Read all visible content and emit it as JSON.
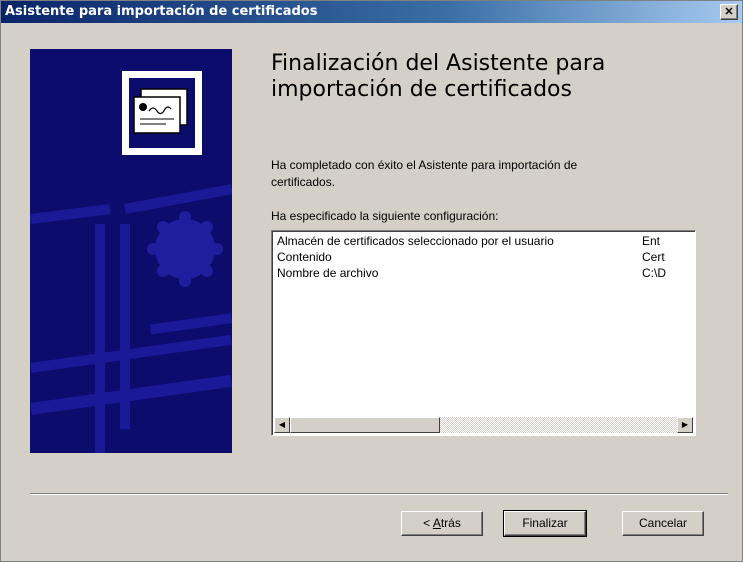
{
  "window": {
    "title": "Asistente para importación de certificados",
    "close_glyph": "✕"
  },
  "main": {
    "heading_line1": "Finalización del Asistente para",
    "heading_line2": "importación de certificados",
    "description_line1": "Ha completado con éxito el Asistente para importación de",
    "description_line2": "certificados.",
    "config_label": "Ha especificado la siguiente configuración:",
    "config_rows": [
      {
        "key": "Almacén de certificados seleccionado por el usuario",
        "value": "Ent"
      },
      {
        "key": "Contenido",
        "value": "Cert"
      },
      {
        "key": "Nombre de archivo",
        "value": "C:\\D"
      }
    ]
  },
  "buttons": {
    "back_prefix": "< ",
    "back_mnemonic": "A",
    "back_rest": "trás",
    "finish": "Finalizar",
    "cancel": "Cancelar"
  },
  "icons": {
    "banner": "certificate-icon",
    "scroll_left": "arrow-left-icon",
    "scroll_right": "arrow-right-icon"
  },
  "colors": {
    "banner_bg": "#0c0c6c",
    "title_gradient_start": "#0a246a"
  }
}
